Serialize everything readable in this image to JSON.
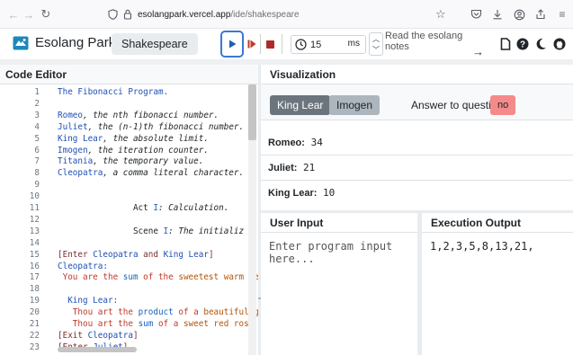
{
  "browser": {
    "host": "esolangpark.vercel.app",
    "path": "/ide/shakespeare"
  },
  "app": {
    "brand": "Esolang Park",
    "language": "Shakespeare",
    "interval_value": "15",
    "interval_unit": "ms",
    "notes_link": "Read the esolang notes",
    "notes_arrow": "→"
  },
  "editor": {
    "title": "Code Editor",
    "lines": [
      {
        "n": "1",
        "parts": [
          {
            "t": "The Fibonacci Program.",
            "c": "c-title"
          }
        ]
      },
      {
        "n": "2",
        "parts": []
      },
      {
        "n": "3",
        "parts": [
          {
            "t": "Romeo",
            "c": "c-name"
          },
          {
            "t": ", the nth fibonacci number.",
            "c": "c-italic"
          }
        ]
      },
      {
        "n": "4",
        "parts": [
          {
            "t": "Juliet",
            "c": "c-name"
          },
          {
            "t": ", the (n-1)th fibonacci number.",
            "c": "c-italic"
          }
        ]
      },
      {
        "n": "5",
        "parts": [
          {
            "t": "King Lear",
            "c": "c-name"
          },
          {
            "t": ", the absolute limit.",
            "c": "c-italic"
          }
        ]
      },
      {
        "n": "6",
        "parts": [
          {
            "t": "Imogen",
            "c": "c-name"
          },
          {
            "t": ", the iteration counter.",
            "c": "c-italic"
          }
        ]
      },
      {
        "n": "7",
        "parts": [
          {
            "t": "Titania",
            "c": "c-name"
          },
          {
            "t": ", the temporary value.",
            "c": "c-italic"
          }
        ]
      },
      {
        "n": "8",
        "parts": [
          {
            "t": "Cleopatra",
            "c": "c-name"
          },
          {
            "t": ", a comma literal character.",
            "c": "c-italic"
          }
        ]
      },
      {
        "n": "9",
        "parts": []
      },
      {
        "n": "10",
        "parts": []
      },
      {
        "n": "11",
        "parts": [
          {
            "t": "               Act ",
            "c": "c-plain"
          },
          {
            "t": "I",
            "c": "c-blue"
          },
          {
            "t": ": Calculation.",
            "c": "c-italic"
          }
        ]
      },
      {
        "n": "12",
        "parts": []
      },
      {
        "n": "13",
        "parts": [
          {
            "t": "               Scene ",
            "c": "c-plain"
          },
          {
            "t": "I",
            "c": "c-blue"
          },
          {
            "t": ": The initializ",
            "c": "c-italic"
          }
        ]
      },
      {
        "n": "14",
        "parts": []
      },
      {
        "n": "15",
        "parts": [
          {
            "t": "[Enter ",
            "c": "c-bracket"
          },
          {
            "t": "Cleopatra",
            "c": "c-name"
          },
          {
            "t": " and ",
            "c": "c-bracket"
          },
          {
            "t": "King Lear",
            "c": "c-name"
          },
          {
            "t": "]",
            "c": "c-bracket"
          }
        ]
      },
      {
        "n": "16",
        "parts": [
          {
            "t": "Cleopatra:",
            "c": "c-name"
          }
        ]
      },
      {
        "n": "17",
        "parts": [
          {
            "t": " You are the ",
            "c": "c-red"
          },
          {
            "t": "sum",
            "c": "c-blue"
          },
          {
            "t": " of the ",
            "c": "c-red"
          },
          {
            "t": "sweetest warm yell",
            "c": "c-brown"
          }
        ]
      },
      {
        "n": "18",
        "parts": []
      },
      {
        "n": "19",
        "parts": [
          {
            "t": "  King Lear:",
            "c": "c-name"
          }
        ]
      },
      {
        "n": "20",
        "parts": [
          {
            "t": "   Thou art the ",
            "c": "c-red"
          },
          {
            "t": "product",
            "c": "c-blue"
          },
          {
            "t": " of a ",
            "c": "c-red"
          },
          {
            "t": "beautiful gree",
            "c": "c-brown"
          }
        ]
      },
      {
        "n": "21",
        "parts": [
          {
            "t": "   Thou art the ",
            "c": "c-red"
          },
          {
            "t": "sum",
            "c": "c-blue"
          },
          {
            "t": " of a ",
            "c": "c-red"
          },
          {
            "t": "sweet red rose",
            "c": "c-brown"
          },
          {
            "t": " and",
            "c": "c-red"
          }
        ]
      },
      {
        "n": "22",
        "parts": [
          {
            "t": "[Exit ",
            "c": "c-bracket"
          },
          {
            "t": "Cleopatra",
            "c": "c-name"
          },
          {
            "t": "]",
            "c": "c-bracket"
          }
        ]
      },
      {
        "n": "23",
        "parts": [
          {
            "t": "[Enter ",
            "c": "c-bracket"
          },
          {
            "t": "Juliet",
            "c": "c-name"
          },
          {
            "t": "]",
            "c": "c-bracket"
          }
        ]
      }
    ]
  },
  "visualization": {
    "title": "Visualization",
    "tabs": [
      "King Lear",
      "Imogen"
    ],
    "answer_label": "Answer to question:",
    "answer_value": "no",
    "characters": [
      {
        "name": "Romeo:",
        "value": "34"
      },
      {
        "name": "Juliet:",
        "value": "21"
      },
      {
        "name": "King Lear:",
        "value": "10"
      }
    ]
  },
  "input": {
    "title": "User Input",
    "placeholder": "Enter program input here..."
  },
  "output": {
    "title": "Execution Output",
    "value": "1,2,3,5,8,13,21,"
  }
}
